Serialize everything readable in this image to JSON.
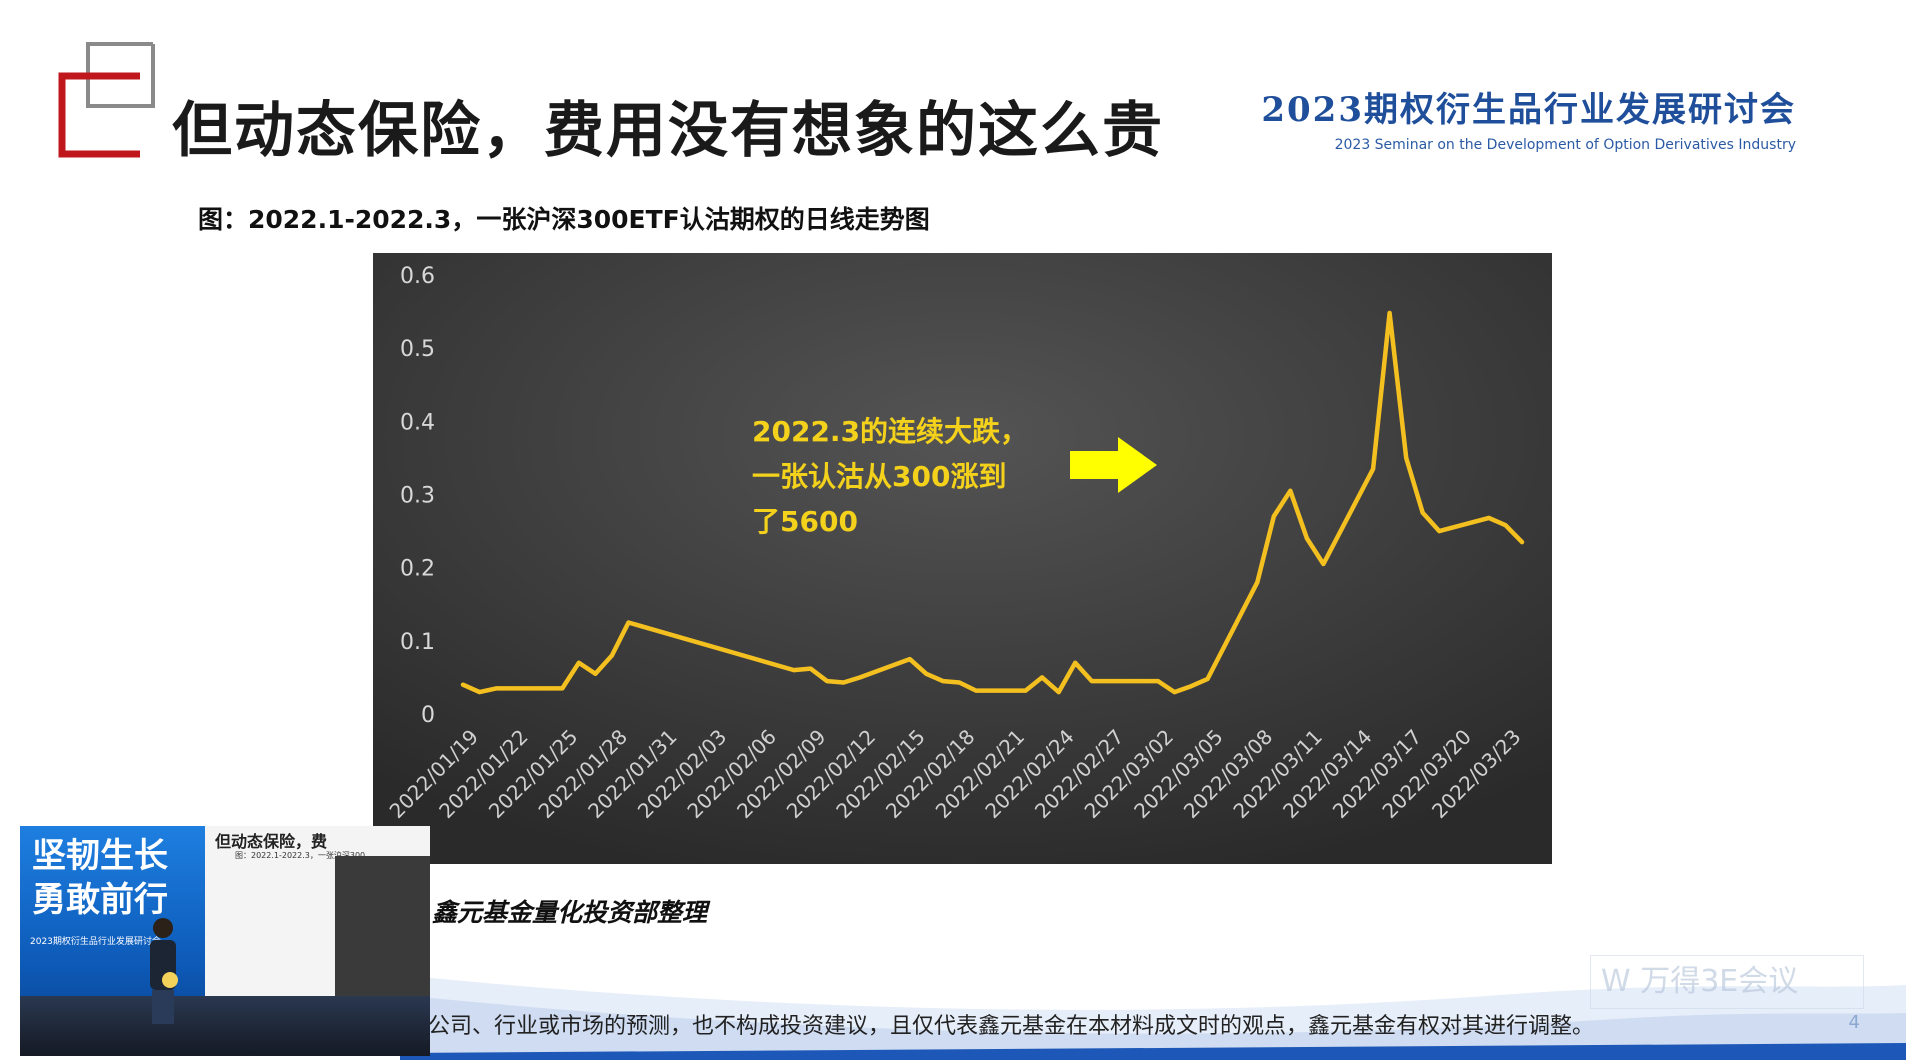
{
  "slide": {
    "title": "但动态保险，费用没有想象的这么贵",
    "brand_title": "2023期权衍生品行业发展研讨会",
    "brand_subtitle": "2023 Seminar on the Development of Option Derivatives Industry",
    "caption": "图：2022.1-2022.3，一张沪深300ETF认沽期权的日线走势图",
    "source": "鑫元基金量化投资部整理",
    "disclaimer": "公司、行业或市场的预测，也不构成投资建议，且仅代表鑫元基金在本材料成文时的观点，鑫元基金有权对其进行调整。",
    "page_number": "4",
    "watermark": "W 万得3E会议"
  },
  "colors": {
    "accent_red": "#c0171c",
    "brand_blue": "#1f4e9a",
    "line_color": "#f4c020",
    "annotation_color": "#f4d21c",
    "arrow_color": "#ffff00"
  },
  "inset_video": {
    "slogan_line1": "坚韧生长",
    "slogan_line2": "勇敢前行",
    "banner_subtitle": "2023期权衍生品行业发展研讨会",
    "slide_title": "但动态保险，费",
    "slide_caption": "图：2022.1-2022.3，一张沪深300"
  },
  "chart_data": {
    "type": "line",
    "title": "",
    "xlabel": "",
    "ylabel": "",
    "ylim": [
      0,
      0.6
    ],
    "yticks": [
      "0",
      "0.1",
      "0.2",
      "0.3",
      "0.4",
      "0.5",
      "0.6"
    ],
    "grid": false,
    "x_tick_labels": [
      "2022/01/19",
      "2022/01/22",
      "2022/01/25",
      "2022/01/28",
      "2022/01/31",
      "2022/02/03",
      "2022/02/06",
      "2022/02/09",
      "2022/02/12",
      "2022/02/15",
      "2022/02/18",
      "2022/02/21",
      "2022/02/24",
      "2022/02/27",
      "2022/03/02",
      "2022/03/05",
      "2022/03/08",
      "2022/03/11",
      "2022/03/14",
      "2022/03/17",
      "2022/03/20",
      "2022/03/23"
    ],
    "series": [
      {
        "x": [
          "2022/01/18",
          "2022/01/19",
          "2022/01/20",
          "2022/01/21",
          "2022/01/24",
          "2022/01/25",
          "2022/01/26",
          "2022/01/27",
          "2022/01/28",
          "2022/02/07",
          "2022/02/08",
          "2022/02/09",
          "2022/02/10",
          "2022/02/11",
          "2022/02/14",
          "2022/02/15",
          "2022/02/16",
          "2022/02/17",
          "2022/02/18",
          "2022/02/21",
          "2022/02/22",
          "2022/02/23",
          "2022/02/24",
          "2022/02/25",
          "2022/02/28",
          "2022/03/01",
          "2022/03/02",
          "2022/03/03",
          "2022/03/04",
          "2022/03/07",
          "2022/03/08",
          "2022/03/09",
          "2022/03/10",
          "2022/03/11",
          "2022/03/14",
          "2022/03/15",
          "2022/03/16",
          "2022/03/17",
          "2022/03/18",
          "2022/03/21",
          "2022/03/22",
          "2022/03/23"
        ],
        "values": [
          0.04,
          0.03,
          0.035,
          0.035,
          0.035,
          0.07,
          0.055,
          0.08,
          0.125,
          0.06,
          0.062,
          0.045,
          0.043,
          0.05,
          0.075,
          0.055,
          0.045,
          0.043,
          0.032,
          0.032,
          0.05,
          0.03,
          0.07,
          0.045,
          0.045,
          0.045,
          0.03,
          0.038,
          0.048,
          0.18,
          0.27,
          0.305,
          0.24,
          0.205,
          0.335,
          0.548,
          0.35,
          0.275,
          0.25,
          0.268,
          0.258,
          0.235
        ]
      }
    ],
    "annotation": {
      "line1": "2022.3的连续大跌，",
      "line2": "一张认沽从300涨到",
      "line3": "了5600"
    }
  }
}
